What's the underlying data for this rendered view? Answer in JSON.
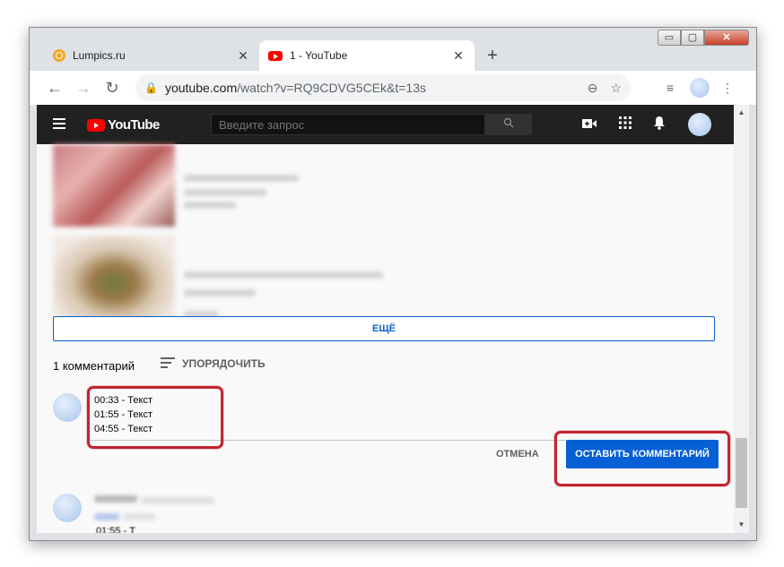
{
  "browser": {
    "tabs": [
      {
        "title": "Lumpics.ru",
        "active": false
      },
      {
        "title": "1 - YouTube",
        "active": true
      }
    ],
    "new_tab": "+",
    "window_controls": {
      "minimize": "▭",
      "maximize": "▢",
      "close": "✕"
    },
    "url": {
      "host": "youtube.com",
      "path": "/watch?v=RQ9CDVG5CEk&t=13s"
    }
  },
  "youtube": {
    "logo_text": "YouTube",
    "search": {
      "placeholder": "Введите запрос"
    },
    "more_button": "ЕЩЁ",
    "comments_count": "1 комментарий",
    "sort_label": "УПОРЯДОЧИТЬ",
    "comment_draft": {
      "lines": [
        "00:33 - Текст",
        "01:55 - Текст",
        "04:55 - Текст"
      ]
    },
    "cancel_button": "ОТМЕНА",
    "submit_button": "ОСТАВИТЬ КОММЕНТАРИЙ",
    "existing_comment_partial": "01:55 - Т"
  },
  "colors": {
    "accent_blue": "#065fd4",
    "highlight_red": "#c22432",
    "yt_red": "#ff0000",
    "yt_header": "#212121"
  },
  "icons": {
    "back": "arrow-left-icon",
    "forward": "arrow-right-icon",
    "reload": "reload-icon",
    "lock": "lock-icon",
    "zoom": "zoom-icon",
    "bookmark": "star-icon",
    "media": "media-control-icon",
    "menu": "kebab-menu-icon",
    "camera": "video-camera-icon",
    "apps": "apps-grid-icon",
    "bell": "bell-icon"
  }
}
